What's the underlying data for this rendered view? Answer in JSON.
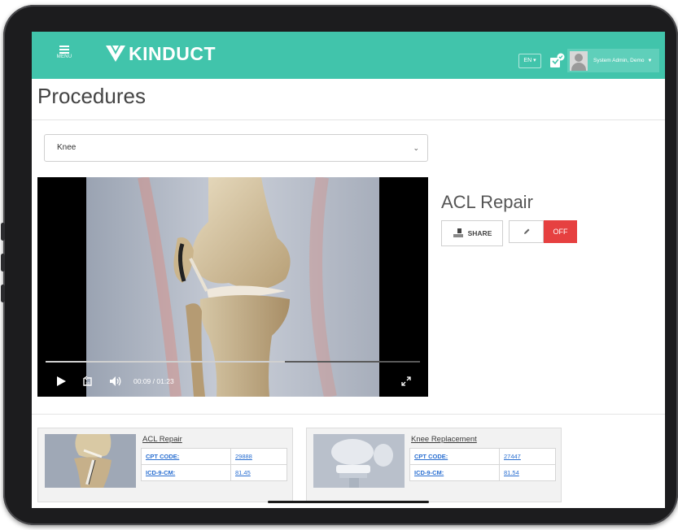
{
  "header": {
    "menu_label": "MENU",
    "brand": "KINDUCT",
    "language": "EN ▾",
    "user_name": "System Admin, Demo",
    "brand_color": "#41c4ab"
  },
  "page": {
    "title": "Procedures",
    "select_value": "Knee"
  },
  "video": {
    "current_time": "00:09",
    "separator": "/",
    "duration": "01:23",
    "progress_fraction": 0.64
  },
  "procedure": {
    "title": "ACL Repair",
    "share_label": "SHARE",
    "off_label": "OFF",
    "off_color": "#e64040"
  },
  "cards": [
    {
      "title": "ACL Repair",
      "rows": [
        {
          "key": "CPT CODE:",
          "value": "29888"
        },
        {
          "key": "ICD-9-CM:",
          "value": "81.45"
        }
      ]
    },
    {
      "title": "Knee Replacement",
      "rows": [
        {
          "key": "CPT CODE:",
          "value": "27447"
        },
        {
          "key": "ICD-9-CM:",
          "value": "81.54"
        }
      ]
    }
  ]
}
